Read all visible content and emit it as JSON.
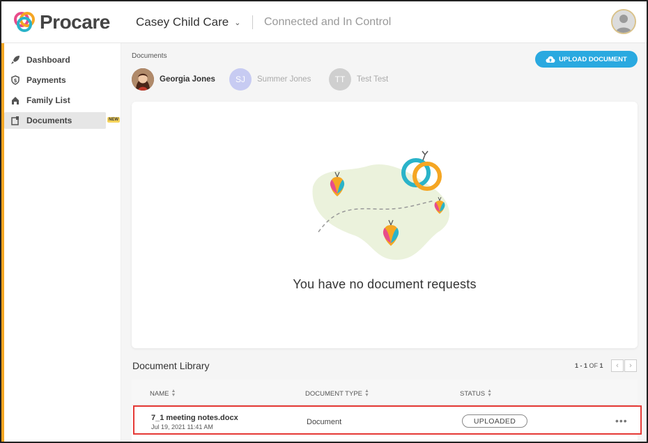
{
  "header": {
    "brand": "Procare",
    "center_name": "Casey Child Care",
    "tagline": "Connected and In Control"
  },
  "sidebar": {
    "items": [
      {
        "label": "Dashboard",
        "icon": "rocket-icon"
      },
      {
        "label": "Payments",
        "icon": "shield-dollar-icon"
      },
      {
        "label": "Family List",
        "icon": "house-icon"
      },
      {
        "label": "Documents",
        "icon": "document-icon",
        "active": true,
        "badge": "NEW"
      }
    ]
  },
  "main": {
    "breadcrumb": "Documents",
    "upload_label": "UPLOAD DOCUMENT",
    "children": [
      {
        "name": "Georgia Jones",
        "initials": "",
        "selected": true
      },
      {
        "name": "Summer Jones",
        "initials": "SJ",
        "selected": false
      },
      {
        "name": "Test Test",
        "initials": "TT",
        "selected": false
      }
    ],
    "empty_message": "You have no document requests",
    "library": {
      "title": "Document Library",
      "pager": {
        "range": "1 - 1",
        "of": "OF",
        "total": "1"
      },
      "columns": [
        "NAME",
        "DOCUMENT TYPE",
        "STATUS"
      ],
      "rows": [
        {
          "name": "7_1 meeting notes.docx",
          "date": "Jul 19, 2021 11:41 AM",
          "type": "Document",
          "status": "UPLOADED"
        }
      ]
    }
  },
  "colors": {
    "accent": "#2aa9e0",
    "sidebar_accent": "#f5a623",
    "highlight_border": "#e53935"
  }
}
